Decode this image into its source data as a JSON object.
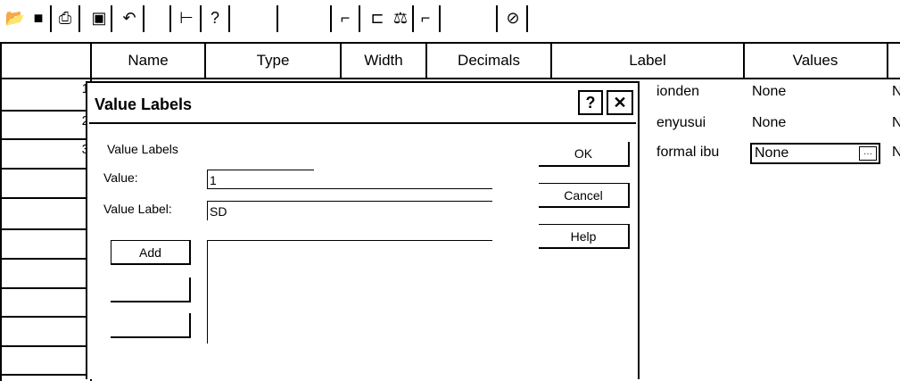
{
  "toolbar": {
    "icons": [
      "open-folder-icon",
      "save-icon",
      "print-icon",
      "dialog-recall-icon",
      "undo-icon",
      "goto-case-icon",
      "variables-icon",
      "insert-cases-icon",
      "split-file-icon",
      "weight-cases-icon",
      "select-cases-icon",
      "value-labels-icon"
    ],
    "glyphs": {
      "open": "📂",
      "save": "■",
      "print": "⎙",
      "recall": "▣",
      "undo": "↶",
      "goto": "⊢",
      "vars": "?",
      "insert": "⌐",
      "split": "⊏",
      "weight": "⚖",
      "select": "⌐",
      "labels": "⊘"
    }
  },
  "grid": {
    "columns": [
      "Name",
      "Type",
      "Width",
      "Decimals",
      "Label",
      "Values"
    ],
    "rows": [
      {
        "num": "1",
        "label": "ionden",
        "values": "None"
      },
      {
        "num": "2",
        "label": "enyusui",
        "values": "None"
      },
      {
        "num": "3",
        "label": "formal ibu",
        "values": "None"
      }
    ],
    "ellipsis": "···",
    "trailing_char": "N"
  },
  "dialog": {
    "title": "Value Labels",
    "help_glyph": "?",
    "close_glyph": "✕",
    "group_label": "Value Labels",
    "value_label": "Value:",
    "value_value": "1",
    "value_label_label": "Value Label:",
    "value_label_value": "SD",
    "buttons": {
      "ok": "OK",
      "cancel": "Cancel",
      "help": "Help",
      "add": "Add"
    }
  }
}
